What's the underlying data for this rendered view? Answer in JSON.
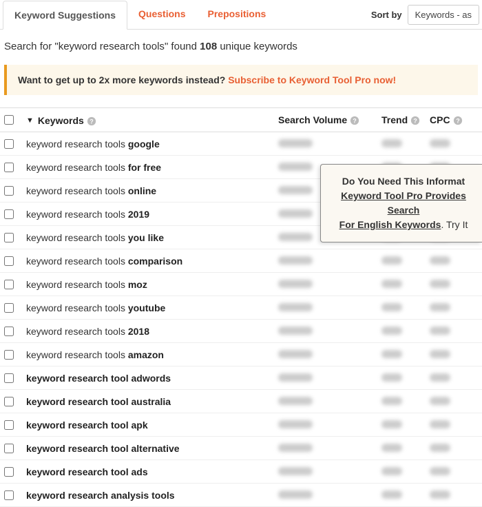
{
  "tabs": {
    "suggestions": "Keyword Suggestions",
    "questions": "Questions",
    "prepositions": "Prepositions"
  },
  "sort": {
    "label": "Sort by",
    "selected": "Keywords - as"
  },
  "summary": {
    "prefix": "Search for \"",
    "term": "keyword research tools",
    "mid": "\" found ",
    "count": "108",
    "suffix": " unique keywords"
  },
  "promo": {
    "lead": "Want to get up to 2x more keywords instead? ",
    "link": "Subscribe to Keyword Tool Pro now!"
  },
  "headers": {
    "keywords": "Keywords",
    "search_volume": "Search Volume",
    "trend": "Trend",
    "cpc": "CPC"
  },
  "popup": {
    "line1": "Do You Need This Informat",
    "line2a": "Keyword Tool Pro Provides Search",
    "line2b": "For English Keywords",
    "line2c": ". Try It"
  },
  "rows": [
    {
      "prefix": "keyword research tools ",
      "bold": "google",
      "allbold": false
    },
    {
      "prefix": "keyword research tools ",
      "bold": "for free",
      "allbold": false
    },
    {
      "prefix": "keyword research tools ",
      "bold": "online",
      "allbold": false
    },
    {
      "prefix": "keyword research tools ",
      "bold": "2019",
      "allbold": false
    },
    {
      "prefix": "keyword research tools ",
      "bold": "you like",
      "allbold": false
    },
    {
      "prefix": "keyword research tools ",
      "bold": "comparison",
      "allbold": false
    },
    {
      "prefix": "keyword research tools ",
      "bold": "moz",
      "allbold": false
    },
    {
      "prefix": "keyword research tools ",
      "bold": "youtube",
      "allbold": false
    },
    {
      "prefix": "keyword research tools ",
      "bold": "2018",
      "allbold": false
    },
    {
      "prefix": "keyword research tools ",
      "bold": "amazon",
      "allbold": false
    },
    {
      "prefix": "",
      "bold": "keyword research tool adwords",
      "allbold": true
    },
    {
      "prefix": "",
      "bold": "keyword research tool australia",
      "allbold": true
    },
    {
      "prefix": "",
      "bold": "keyword research tool apk",
      "allbold": true
    },
    {
      "prefix": "",
      "bold": "keyword research tool alternative",
      "allbold": true
    },
    {
      "prefix": "",
      "bold": "keyword research tool ads",
      "allbold": true
    },
    {
      "prefix": "",
      "bold": "keyword research analysis tools",
      "allbold": true
    }
  ]
}
